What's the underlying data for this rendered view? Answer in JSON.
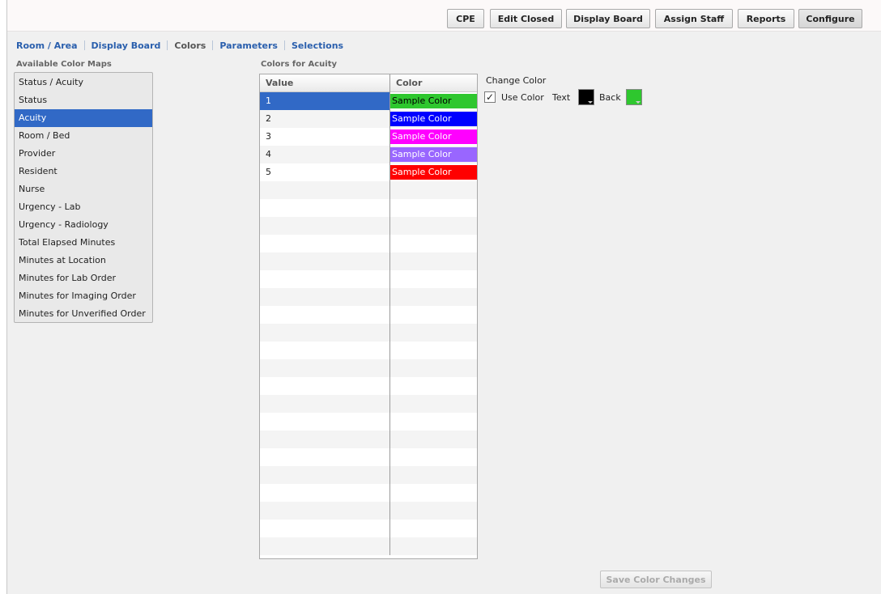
{
  "toolbar": {
    "buttons": [
      {
        "label": "CPE"
      },
      {
        "label": "Edit Closed"
      },
      {
        "label": "Display Board"
      },
      {
        "label": "Assign Staff"
      },
      {
        "label": "Reports"
      },
      {
        "label": "Configure",
        "active": true
      }
    ]
  },
  "subnav": {
    "items": [
      {
        "label": "Room / Area"
      },
      {
        "label": "Display Board"
      },
      {
        "label": "Colors",
        "current": true
      },
      {
        "label": "Parameters"
      },
      {
        "label": "Selections"
      }
    ]
  },
  "color_maps": {
    "title": "Available Color Maps",
    "selected_index": 2,
    "items": [
      "Status / Acuity",
      "Status",
      "Acuity",
      "Room / Bed",
      "Provider",
      "Resident",
      "Nurse",
      "Urgency - Lab",
      "Urgency - Radiology",
      "Total Elapsed Minutes",
      "Minutes at Location",
      "Minutes for Lab Order",
      "Minutes for Imaging Order",
      "Minutes for Unverified Order"
    ]
  },
  "colors_table": {
    "title": "Colors for Acuity",
    "headers": {
      "value": "Value",
      "color": "Color"
    },
    "selected_index": 0,
    "rows": [
      {
        "value": "1",
        "sample": "Sample Color",
        "text_color": "#000000",
        "back_color": "#2ec72e"
      },
      {
        "value": "2",
        "sample": "Sample Color",
        "text_color": "#ffffff",
        "back_color": "#0000ff"
      },
      {
        "value": "3",
        "sample": "Sample Color",
        "text_color": "#ffffff",
        "back_color": "#ff00ff"
      },
      {
        "value": "4",
        "sample": "Sample Color",
        "text_color": "#ffffff",
        "back_color": "#9966ff"
      },
      {
        "value": "5",
        "sample": "Sample Color",
        "text_color": "#ffffff",
        "back_color": "#ff0000"
      }
    ],
    "empty_rows": 21
  },
  "change_color": {
    "title": "Change Color",
    "use_color_label": "Use Color",
    "use_color_checked": true,
    "check_mark": "✓",
    "text_label": "Text",
    "text_color": "#000000",
    "back_label": "Back",
    "back_color": "#2ec72e"
  },
  "save_button": {
    "label": "Save Color Changes",
    "enabled": false
  },
  "colors": {
    "accent": "#3169c6",
    "link": "#2a5fad"
  }
}
